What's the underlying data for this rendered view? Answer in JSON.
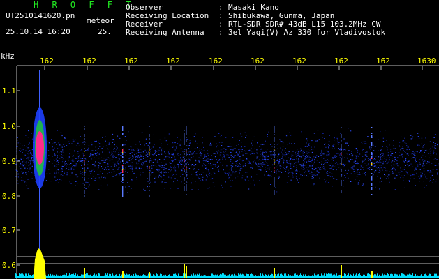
{
  "header": {
    "title": "H R O F F T",
    "filename": "UT2510141620.pn",
    "kind": "meteor",
    "datetime": "25.10.14 16:20",
    "duration": "25.",
    "info": [
      {
        "label": "Observer",
        "sep": ":",
        "value": "Masaki Kano"
      },
      {
        "label": "Receiving Location",
        "sep": ":",
        "value": "Shibukawa, Gunma, Japan"
      },
      {
        "label": "Receiver",
        "sep": ":",
        "value": "RTL-SDR SDR# 43dB L15 103.2MHz CW"
      },
      {
        "label": "Receiving Antenna",
        "sep": ":",
        "value": "3el Yagi(V) Az 330 for Vladivostok"
      }
    ]
  },
  "axes": {
    "y_unit": "kHz",
    "y_ticks": [
      "1.1",
      "1.0",
      "0.9",
      "0.8",
      "0.7",
      "0.6"
    ],
    "x_ticks": [
      "162",
      "162",
      "162",
      "162",
      "162",
      "162",
      "162",
      "162",
      "162",
      "1630"
    ]
  },
  "colors": {
    "background": "#000000",
    "text": "#ffffff",
    "tick_labels": "#ffff00",
    "title": "#22ee22",
    "signal": "#ff2a8a",
    "noise": "#1a2fd0",
    "baseline": "#00e0ff"
  }
}
